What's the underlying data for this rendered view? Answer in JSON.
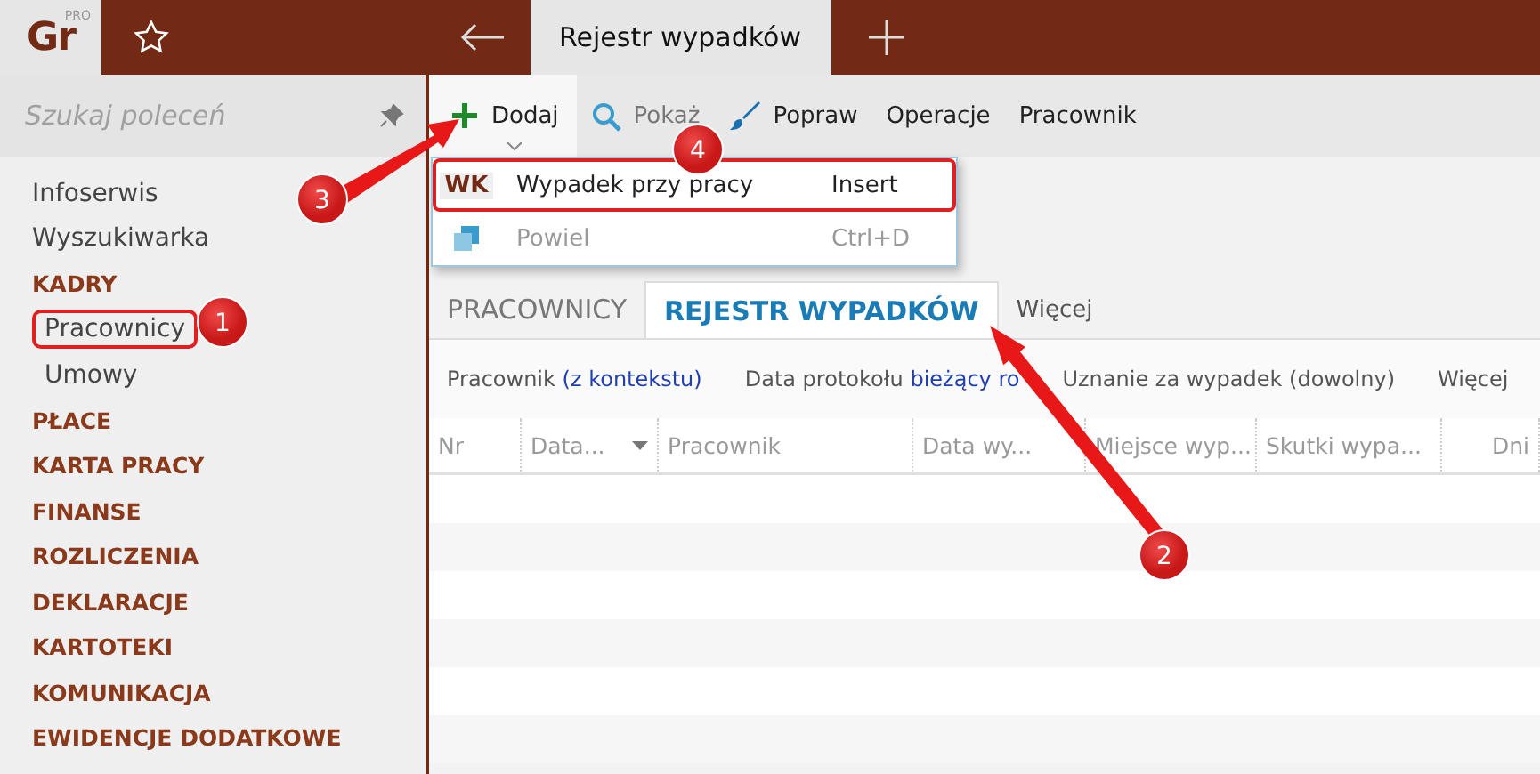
{
  "app": {
    "logo": "Gr",
    "logo_badge": "PRO"
  },
  "tabs": [
    {
      "label": "Rejestr wypadków",
      "selected": true
    }
  ],
  "sidebar": {
    "search": {
      "placeholder": "Szukaj poleceń"
    },
    "items": [
      {
        "label": "Infoserwis",
        "kind": "link",
        "selected": false
      },
      {
        "label": "Wyszukiwarka",
        "kind": "link",
        "selected": false
      },
      {
        "label": "KADRY",
        "kind": "section",
        "selected": false
      },
      {
        "label": "Pracownicy",
        "kind": "sub",
        "selected": true
      },
      {
        "label": "Umowy",
        "kind": "sub",
        "selected": false
      },
      {
        "label": "PŁACE",
        "kind": "section",
        "selected": false
      },
      {
        "label": "KARTA PRACY",
        "kind": "section",
        "selected": false
      },
      {
        "label": "FINANSE",
        "kind": "section",
        "selected": false
      },
      {
        "label": "ROZLICZENIA",
        "kind": "section",
        "selected": false
      },
      {
        "label": "DEKLARACJE",
        "kind": "section",
        "selected": false
      },
      {
        "label": "KARTOTEKI",
        "kind": "section",
        "selected": false
      },
      {
        "label": "KOMUNIKACJA",
        "kind": "section",
        "selected": false
      },
      {
        "label": "EWIDENCJE DODATKOWE",
        "kind": "section",
        "selected": false
      }
    ]
  },
  "toolbar": [
    {
      "label": "Dodaj",
      "kind": "add"
    },
    {
      "label": "Pokaż",
      "kind": "show"
    },
    {
      "label": "Popraw",
      "kind": "edit"
    },
    {
      "label": "Operacje",
      "kind": "plain"
    },
    {
      "label": "Pracownik",
      "kind": "plain"
    }
  ],
  "menu": [
    {
      "badge": "WK",
      "label": "Wypadek przy pracy",
      "shortcut": "Insert",
      "disabled": false
    },
    {
      "label": "Powiel",
      "shortcut": "Ctrl+D",
      "disabled": true
    }
  ],
  "view_tabs": [
    {
      "label": "PRACOWNICY",
      "selected": false
    },
    {
      "label": "REJESTR WYPADKÓW",
      "selected": true
    },
    {
      "label": "Więcej",
      "selected": false
    }
  ],
  "filters": [
    {
      "label": "Pracownik",
      "value": "(z kontekstu)"
    },
    {
      "label": "Data protokołu",
      "value": "bieżący ro"
    },
    {
      "label": "Uznanie za wypadek (dowolny)"
    },
    {
      "label": "Więcej"
    }
  ],
  "table": {
    "columns": [
      {
        "label": "Nr",
        "sorted": false
      },
      {
        "label": "Data...",
        "sorted": true
      },
      {
        "label": "Pracownik",
        "sorted": false
      },
      {
        "label": "Data wy...",
        "sorted": false
      },
      {
        "label": "Miejsce wyp...",
        "sorted": false
      },
      {
        "label": "Skutki wypa...",
        "sorted": false
      },
      {
        "label": "Dni",
        "sorted": false
      }
    ]
  },
  "annotations": [
    {
      "number": "1"
    },
    {
      "number": "2"
    },
    {
      "number": "3"
    },
    {
      "number": "4"
    }
  ]
}
